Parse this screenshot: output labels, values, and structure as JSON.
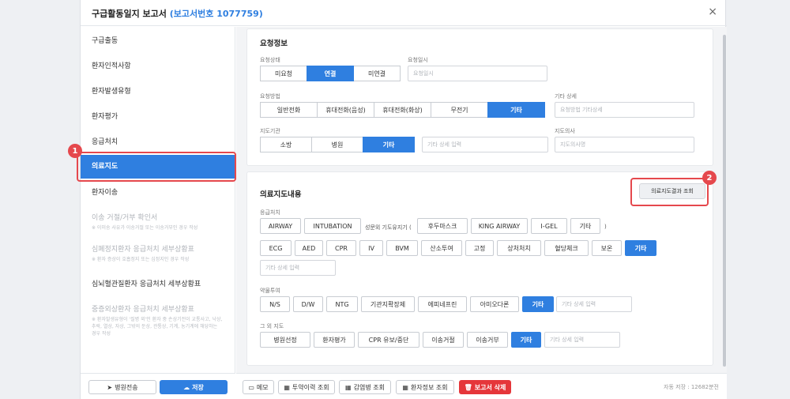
{
  "header": {
    "title": "구급활동일지 보고서",
    "report_no": "(보고서번호 1077759)",
    "close_icon": "×"
  },
  "sidebar": {
    "items": [
      {
        "label": "구급출동"
      },
      {
        "label": "환자인적사항"
      },
      {
        "label": "환자발생유형"
      },
      {
        "label": "환자평가"
      },
      {
        "label": "응급처치"
      },
      {
        "label": "의료지도"
      },
      {
        "label": "환자이송"
      },
      {
        "label": "이송 거절/거부 확인서",
        "sub": "※ 이미송 사유가 이송거절 또는 이송거부인 경우 작성"
      },
      {
        "label": "심폐정지환자 응급처치 세부상황표",
        "sub": "※ 환자 증상이 호흡정지 또는 심정지인 경우 작성"
      },
      {
        "label": "심뇌혈관질환자 응급처치 세부상황표"
      },
      {
        "label": "중증외상환자 응급처치 세부상황표",
        "sub": "※ 환자발생유형이 '질병 외'인 환자 중 손상기전이 교통사고, 낙상, 추락, 열상, 자상, 그밖의 둔상, 관통상, 기계, 농기계에 해당하는 경우 작성"
      }
    ],
    "transfer_label": "병원전송",
    "save_label": "저장"
  },
  "request": {
    "title": "요청정보",
    "status_label": "요청상태",
    "status_options": [
      "미요청",
      "연결",
      "미연결"
    ],
    "datetime_label": "요청일시",
    "datetime_placeholder": "요청일시",
    "method_label": "요청방법",
    "method_options": [
      "일반전화",
      "휴대전화(음성)",
      "휴대전화(화상)",
      "무전기",
      "기타"
    ],
    "other_detail_label": "기타 상세",
    "other_detail_placeholder": "요청방법 기타상세",
    "org_label": "지도기관",
    "org_options": [
      "소방",
      "병원",
      "기타"
    ],
    "org_detail_placeholder": "기타 상세 입력",
    "doctor_label": "지도의사",
    "doctor_placeholder": "지도의사명"
  },
  "guidance": {
    "title": "의료지도내용",
    "result_button": "의료지도결과 조회",
    "aid_label": "응급처치",
    "airway_items": [
      "AIRWAY",
      "INTUBATION"
    ],
    "sga_prefix": "성문외 기도유지기 (",
    "sga_items": [
      "후두마스크",
      "KING AIRWAY",
      "I-GEL",
      "기타"
    ],
    "sga_suffix": ")",
    "aid_items": [
      "ECG",
      "AED",
      "CPR",
      "IV",
      "BVM",
      "산소투여",
      "고정",
      "상처처치",
      "혈당체크",
      "보온",
      "기타"
    ],
    "aid_detail_placeholder": "기타 상세 입력",
    "drug_label": "약물투여",
    "drug_items": [
      "N/S",
      "D/W",
      "NTG",
      "기관지확장제",
      "에피네프린",
      "아미오다론",
      "기타"
    ],
    "drug_detail_placeholder": "기타 상세 입력",
    "other_label": "그 외 지도",
    "other_items": [
      "병원선정",
      "환자평가",
      "CPR 유보/중단",
      "이송거절",
      "이송거부",
      "기타"
    ],
    "other_detail_placeholder": "기타 상세 입력"
  },
  "footer": {
    "buttons": [
      "메모",
      "투약이력 조회",
      "감염병 조회",
      "환자정보 조회"
    ],
    "delete_label": "보고서 삭제",
    "autosave": "자동 저장 : 12682분전"
  },
  "markers": [
    "1",
    "2"
  ],
  "colors": {
    "accent": "#2f7fe0",
    "danger": "#e5363a",
    "highlight": "#e5484d"
  }
}
